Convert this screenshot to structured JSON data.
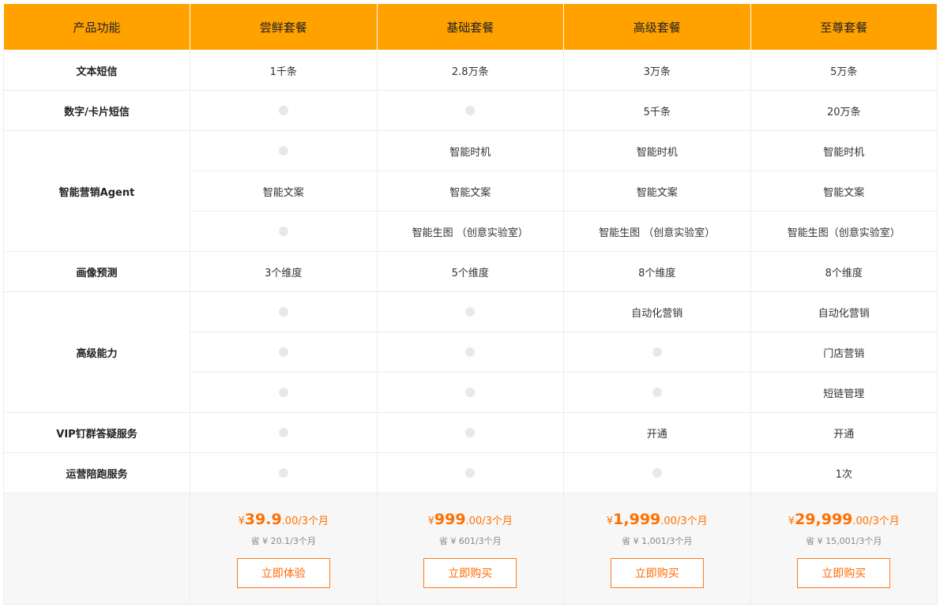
{
  "header": [
    "产品功能",
    "尝鲜套餐",
    "基础套餐",
    "高级套餐",
    "至尊套餐"
  ],
  "features": {
    "sms": "文本短信",
    "digital": "数字/卡片短信",
    "agent": "智能营销Agent",
    "profile": "画像预测",
    "advanced": "高级能力",
    "vip": "VIP钉群答疑服务",
    "ops": "运营陪跑服务"
  },
  "values": {
    "sms": [
      "1千条",
      "2.8万条",
      "3万条",
      "5万条"
    ],
    "digital": [
      "",
      "",
      "5千条",
      "20万条"
    ],
    "agent_timing": [
      "",
      "智能时机",
      "智能时机",
      "智能时机"
    ],
    "agent_copy": [
      "智能文案",
      "智能文案",
      "智能文案",
      "智能文案"
    ],
    "agent_image": [
      "",
      "智能生图 （创意实验室）",
      "智能生图 （创意实验室）",
      "智能生图（创意实验室）"
    ],
    "profile": [
      "3个维度",
      "5个维度",
      "8个维度",
      "8个维度"
    ],
    "adv_auto": [
      "",
      "",
      "自动化营销",
      "自动化营销"
    ],
    "adv_store": [
      "",
      "",
      "",
      "门店营销"
    ],
    "adv_link": [
      "",
      "",
      "",
      "短链管理"
    ],
    "vip": [
      "",
      "",
      "开通",
      "开通"
    ],
    "ops": [
      "",
      "",
      "",
      "1次"
    ]
  },
  "plans": [
    {
      "currency": "¥",
      "price": "39.9",
      "suffix": ".00/3个月",
      "save": "省 ¥ 20.1/3个月",
      "button": "立即体验"
    },
    {
      "currency": "¥",
      "price": "999",
      "suffix": ".00/3个月",
      "save": "省 ¥ 601/3个月",
      "button": "立即购买"
    },
    {
      "currency": "¥",
      "price": "1,999",
      "suffix": ".00/3个月",
      "save": "省 ¥ 1,001/3个月",
      "button": "立即购买"
    },
    {
      "currency": "¥",
      "price": "29,999",
      "suffix": ".00/3个月",
      "save": "省 ¥ 15,001/3个月",
      "button": "立即购买"
    }
  ],
  "colors": {
    "header_bg": "#ffa200",
    "accent": "#ff7000",
    "dot": "#e8e8e8",
    "price_bg": "#f7f7f7"
  }
}
